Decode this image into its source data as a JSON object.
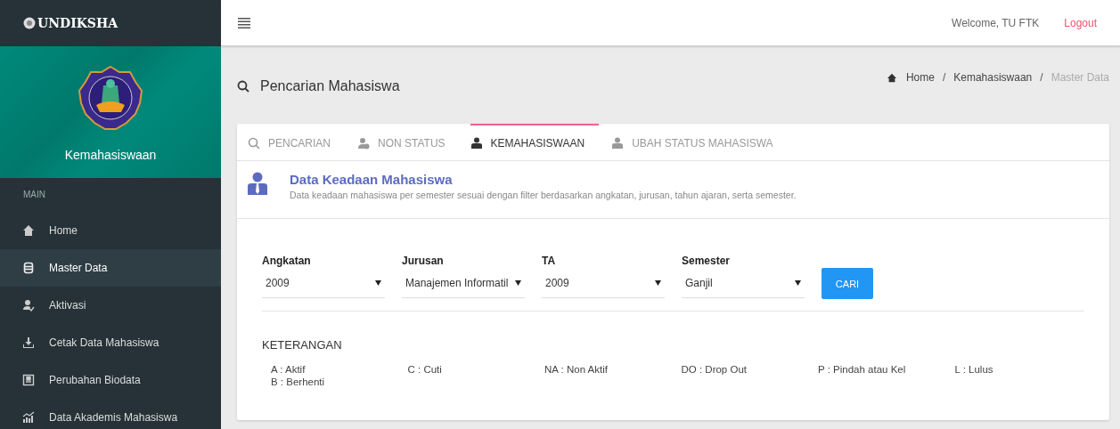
{
  "brand": "UNDIKSHA",
  "profile": {
    "name": "Kemahasiswaan"
  },
  "sidebar": {
    "section": "MAIN",
    "items": [
      {
        "label": "Home",
        "kind": "home",
        "selected": false
      },
      {
        "label": "Master Data",
        "kind": "database",
        "selected": true
      },
      {
        "label": "Aktivasi",
        "kind": "activation",
        "selected": false
      },
      {
        "label": "Cetak Data Mahasiswa",
        "kind": "print",
        "selected": false
      },
      {
        "label": "Perubahan Biodata",
        "kind": "biodata",
        "selected": false
      },
      {
        "label": "Data Akademis Mahasiswa",
        "kind": "academic",
        "selected": false
      }
    ]
  },
  "topbar": {
    "welcome": "Welcome, TU FTK",
    "logout": "Logout"
  },
  "page_title": "Pencarian Mahasiswa",
  "breadcrumb": {
    "separator": "/",
    "items": [
      "Home",
      "Kemahasiswaan",
      "Master Data"
    ]
  },
  "tabs": [
    {
      "label": "PENCARIAN",
      "kind": "search",
      "selected": false
    },
    {
      "label": "NON STATUS",
      "kind": "nonstatus",
      "selected": false
    },
    {
      "label": "KEMAHASISWAAN",
      "kind": "student",
      "selected": true
    },
    {
      "label": "UBAH STATUS MAHASISWA",
      "kind": "student",
      "selected": false
    }
  ],
  "section": {
    "title": "Data Keadaan Mahasiswa",
    "description": "Data keadaan mahasiswa per semester sesuai dengan filter berdasarkan angkatan, jurusan, tahun ajaran, serta semester."
  },
  "filters": [
    {
      "label": "Angkatan",
      "value": "2009"
    },
    {
      "label": "Jurusan",
      "value": "Manajemen Informatil"
    },
    {
      "label": "TA",
      "value": "2009"
    },
    {
      "label": "Semester",
      "value": "Ganjil"
    }
  ],
  "search_button": "CARI",
  "legend": {
    "title": "KETERANGAN",
    "items": [
      "A : Aktif",
      "C : Cuti",
      "NA : Non Aktif",
      "DO : Drop Out",
      "P : Pindah atau Kel",
      "L : Lulus",
      "B : Berhenti"
    ]
  }
}
